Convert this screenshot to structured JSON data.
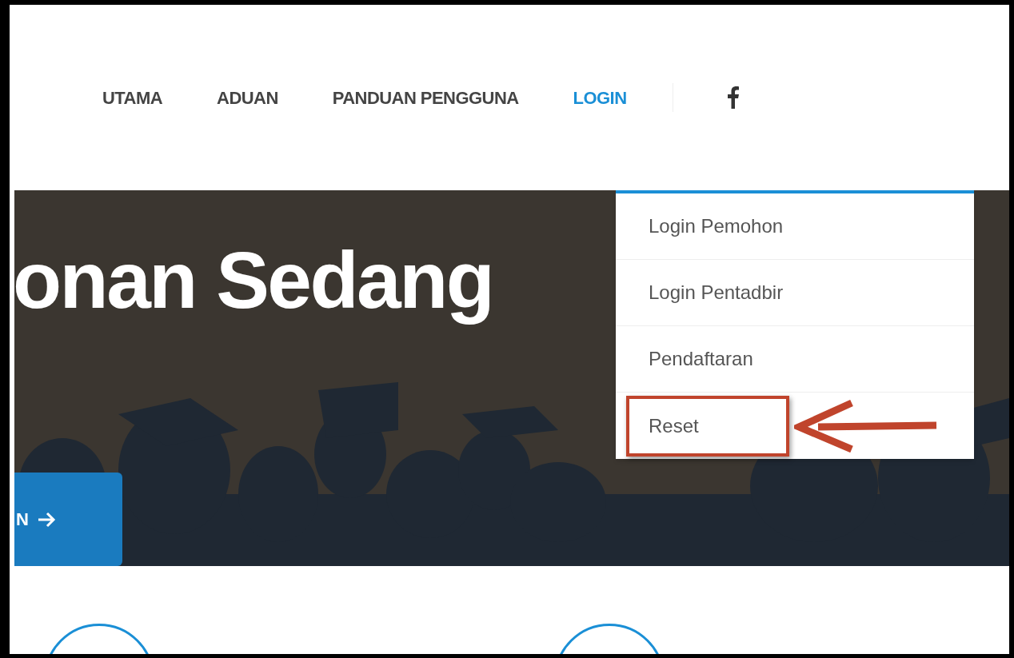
{
  "nav": [
    {
      "label": "UTAMA",
      "selected": false
    },
    {
      "label": "ADUAN",
      "selected": false
    },
    {
      "label": "PANDUAN PENGGUNA",
      "selected": false
    },
    {
      "label": "LOGIN",
      "selected": true
    }
  ],
  "hero": {
    "title": "onan Sedang",
    "button": "N"
  },
  "dropdown": [
    {
      "label": "Login Pemohon",
      "highlighted": false
    },
    {
      "label": "Login Pentadbir",
      "highlighted": false
    },
    {
      "label": "Pendaftaran",
      "highlighted": false
    },
    {
      "label": "Reset",
      "highlighted": true
    }
  ]
}
